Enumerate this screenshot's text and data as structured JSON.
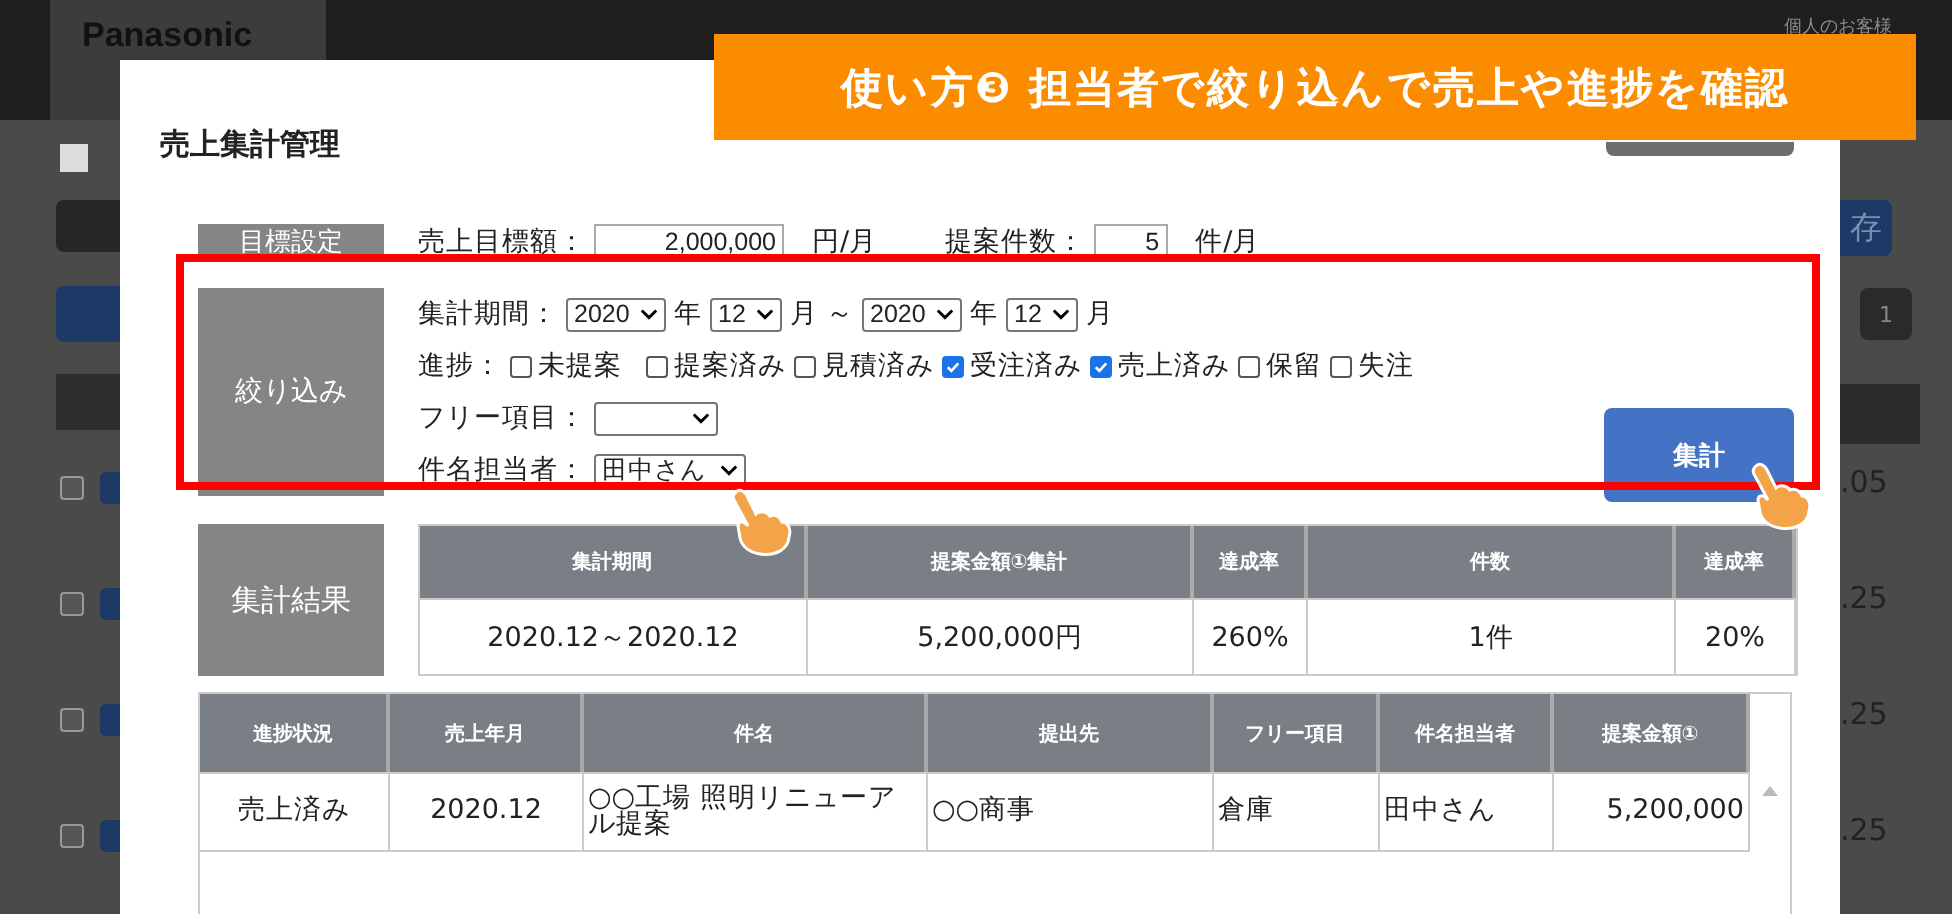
{
  "background_page": {
    "logo": "Panasonic",
    "header_link": "個人のお客様",
    "save_button": "存",
    "page_number": "1",
    "rows": [
      {
        "checked": false,
        "value": ".05"
      },
      {
        "checked": false,
        "value": ".25"
      },
      {
        "checked": false,
        "value": ".25"
      },
      {
        "checked": false,
        "value": ".25"
      }
    ]
  },
  "banner": {
    "text": "使い方❸ 担当者で絞り込んで売上や進捗を確認"
  },
  "modal": {
    "title": "売上集計管理",
    "target": {
      "label": "目標設定",
      "amount_label": "売上目標額：",
      "amount_value": "2,000,000",
      "amount_unit": "円/月",
      "count_label": "提案件数：",
      "count_value": "5",
      "count_unit": "件/月"
    },
    "filter": {
      "label": "絞り込み",
      "period_label": "集計期間：",
      "from_year": "2020",
      "year_unit_1": "年",
      "from_month": "12",
      "month_unit_1": "月",
      "separator": "～",
      "to_year": "2020",
      "year_unit_2": "年",
      "to_month": "12",
      "month_unit_2": "月",
      "status_label": "進捗：",
      "statuses": [
        {
          "label": "未提案",
          "checked": false
        },
        {
          "label": "提案済み",
          "checked": false
        },
        {
          "label": "見積済み",
          "checked": false
        },
        {
          "label": "受注済み",
          "checked": true
        },
        {
          "label": "売上済み",
          "checked": true
        },
        {
          "label": "保留",
          "checked": false
        },
        {
          "label": "失注",
          "checked": false
        }
      ],
      "free_label": "フリー項目：",
      "owner_label": "件名担当者：",
      "owner_value": "田中さん",
      "button": "集計"
    },
    "results": {
      "label": "集計結果",
      "columns": [
        "集計期間",
        "提案金額①集計",
        "達成率",
        "件数",
        "達成率"
      ],
      "row": [
        "2020.12～2020.12",
        "5,200,000円",
        "260%",
        "1件",
        "20%"
      ]
    },
    "table": {
      "columns": [
        "進捗状況",
        "売上年月",
        "件名",
        "提出先",
        "フリー項目",
        "件名担当者",
        "提案金額①"
      ],
      "rows": [
        [
          "売上済み",
          "2020.12",
          "○○工場 照明リニューアル提案",
          "○○商事",
          "倉庫",
          "田中さん",
          "5,200,000"
        ]
      ]
    }
  }
}
